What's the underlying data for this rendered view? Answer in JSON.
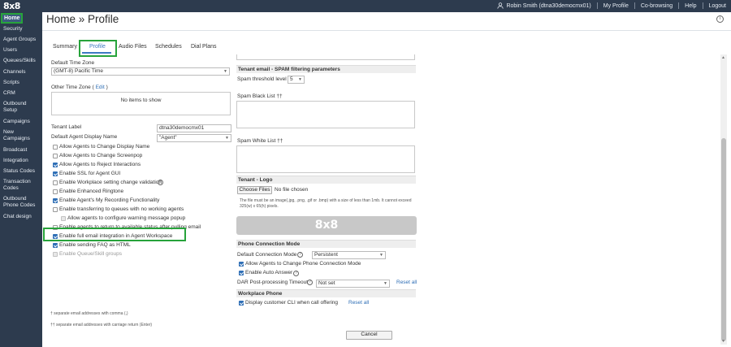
{
  "app": {
    "logo": "8x8"
  },
  "topbar": {
    "user": "Robin Smith (dtna30democmx01)",
    "links": [
      "My Profile",
      "Co-browsing",
      "Help",
      "Logout"
    ]
  },
  "sidebar": {
    "home": "Home",
    "items": [
      "Security",
      "Agent Groups",
      "Users",
      "Queues/Skills",
      "Channels",
      "Scripts",
      "CRM",
      "Outbound Setup",
      "Campaigns",
      "New Campaigns",
      "Broadcast",
      "Integration",
      "Status Codes",
      "Transaction Codes",
      "Outbound Phone Codes",
      "Chat design"
    ]
  },
  "header": {
    "title": "Home » Profile",
    "info": "i"
  },
  "tabs": [
    "Summary",
    "Profile",
    "Audio Files",
    "Schedules",
    "Dial Plans"
  ],
  "left": {
    "default_tz_label": "Default Time Zone",
    "default_tz_value": "(GMT-8) Pacific Time",
    "other_tz_label": "Other Time Zone (",
    "other_tz_edit": "Edit",
    "other_tz_close": ")",
    "no_items": "No items to show",
    "tenant_label": "Tenant Label",
    "tenant_value": "dtna30democmx01",
    "agent_display_label": "Default Agent Display Name",
    "agent_display_value": "\"Agent\"",
    "checkboxes": [
      "Allow Agents to Change Display Name",
      "Allow Agents to Change Screenpop",
      "Allow Agents to Reject Interactions",
      "Enable SSL for Agent GUI",
      "Enable Workplace setting change validation",
      "Enable Enhanced Ringtone",
      "Enable Agent's My Recording Functionality",
      "Enable transferring to queues with no working agents",
      "Allow agents to configure warning message popup",
      "Enable agents to return to available status after pulling email",
      "Enable full email integration in Agent Workspace",
      "Enable sending FAQ as HTML",
      "Enable Queue/Skill groups"
    ],
    "help_glyph": "?",
    "footnote1": "† separate email addresses with comma (,)",
    "footnote2": "†† separate email addresses with carriage return (Enter)"
  },
  "right": {
    "spam_header": "Tenant email - SPAM filtering parameters",
    "spam_threshold_label": "Spam threshold level",
    "spam_threshold_value": "5",
    "black_list_label": "Spam Black List ††",
    "white_list_label": "Spam White List ††",
    "logo_header": "Tenant - Logo",
    "choose_files": "Choose Files",
    "no_file": "No file chosen",
    "logo_hint": "The file must be an image(.jpg, .png, .gif or .bmp) with a size of less than 1mb. It cannot exceed 325(w) x 65(h) pixels.",
    "logo_preview": "8x8",
    "phone_header": "Phone Connection Mode",
    "default_conn_label": "Default Connection Mode",
    "default_conn_value": "Persistent",
    "allow_change_conn": "Allow Agents to Change Phone Connection Mode",
    "enable_auto_answer": "Enable Auto Answer",
    "dar_label": "DAR Post-processing Timeout",
    "dar_value": "Not set",
    "reset_all": "Reset all",
    "workplace_header": "Workplace Phone",
    "display_cli": "Display customer CLI when call offering",
    "reset_all_2": "Reset all"
  },
  "footer": {
    "cancel": "Cancel"
  }
}
